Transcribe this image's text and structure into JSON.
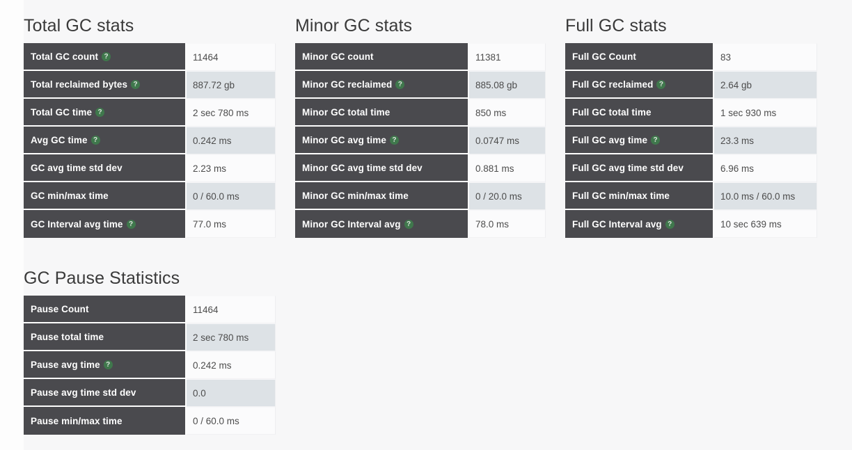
{
  "theme": {
    "page_background": "#f7f7f8",
    "label_cell_background": "#4a4a4e",
    "label_cell_text": "#ffffff",
    "value_row_odd_background": "#fbfbfc",
    "value_row_even_background": "#dde2e6",
    "value_text": "#4c4c4c",
    "heading_text": "#3a3a3a",
    "help_icon_color": "#3f7c4c"
  },
  "help_icon_name": "help-question-icon",
  "panels": [
    {
      "id": "total-gc-stats",
      "title": "Total GC stats",
      "rows": [
        {
          "label": "Total GC count",
          "help": true,
          "value": "11464"
        },
        {
          "label": "Total reclaimed bytes",
          "help": true,
          "value": "887.72 gb"
        },
        {
          "label": "Total GC time",
          "help": true,
          "value": "2 sec 780 ms"
        },
        {
          "label": "Avg GC time",
          "help": true,
          "value": "0.242 ms"
        },
        {
          "label": "GC avg time std dev",
          "help": false,
          "value": "2.23 ms"
        },
        {
          "label": "GC min/max time",
          "help": false,
          "value": "0 / 60.0 ms"
        },
        {
          "label": "GC Interval avg time",
          "help": true,
          "value": "77.0 ms"
        }
      ]
    },
    {
      "id": "minor-gc-stats",
      "title": "Minor GC stats",
      "rows": [
        {
          "label": "Minor GC count",
          "help": false,
          "value": "11381"
        },
        {
          "label": "Minor GC reclaimed",
          "help": true,
          "value": "885.08 gb"
        },
        {
          "label": "Minor GC total time",
          "help": false,
          "value": "850 ms"
        },
        {
          "label": "Minor GC avg time",
          "help": true,
          "value": "0.0747 ms"
        },
        {
          "label": "Minor GC avg time std dev",
          "help": false,
          "value": "0.881 ms"
        },
        {
          "label": "Minor GC min/max time",
          "help": false,
          "value": "0 / 20.0 ms"
        },
        {
          "label": "Minor GC Interval avg",
          "help": true,
          "value": "78.0 ms"
        }
      ]
    },
    {
      "id": "full-gc-stats",
      "title": "Full GC stats",
      "rows": [
        {
          "label": "Full GC Count",
          "help": false,
          "value": "83"
        },
        {
          "label": "Full GC reclaimed",
          "help": true,
          "value": "2.64 gb"
        },
        {
          "label": "Full GC total time",
          "help": false,
          "value": "1 sec 930 ms"
        },
        {
          "label": "Full GC avg time",
          "help": true,
          "value": "23.3 ms"
        },
        {
          "label": "Full GC avg time std dev",
          "help": false,
          "value": "6.96 ms"
        },
        {
          "label": "Full GC min/max time",
          "help": false,
          "value": "10.0 ms / 60.0 ms"
        },
        {
          "label": "Full GC Interval avg",
          "help": true,
          "value": "10 sec 639 ms"
        }
      ]
    },
    {
      "id": "gc-pause-statistics",
      "title": "GC Pause Statistics",
      "rows": [
        {
          "label": "Pause Count",
          "help": false,
          "value": "11464"
        },
        {
          "label": "Pause total time",
          "help": false,
          "value": "2 sec 780 ms"
        },
        {
          "label": "Pause avg time",
          "help": true,
          "value": "0.242 ms"
        },
        {
          "label": "Pause avg time std dev",
          "help": false,
          "value": "0.0"
        },
        {
          "label": "Pause min/max time",
          "help": false,
          "value": "0 / 60.0 ms"
        }
      ]
    }
  ]
}
